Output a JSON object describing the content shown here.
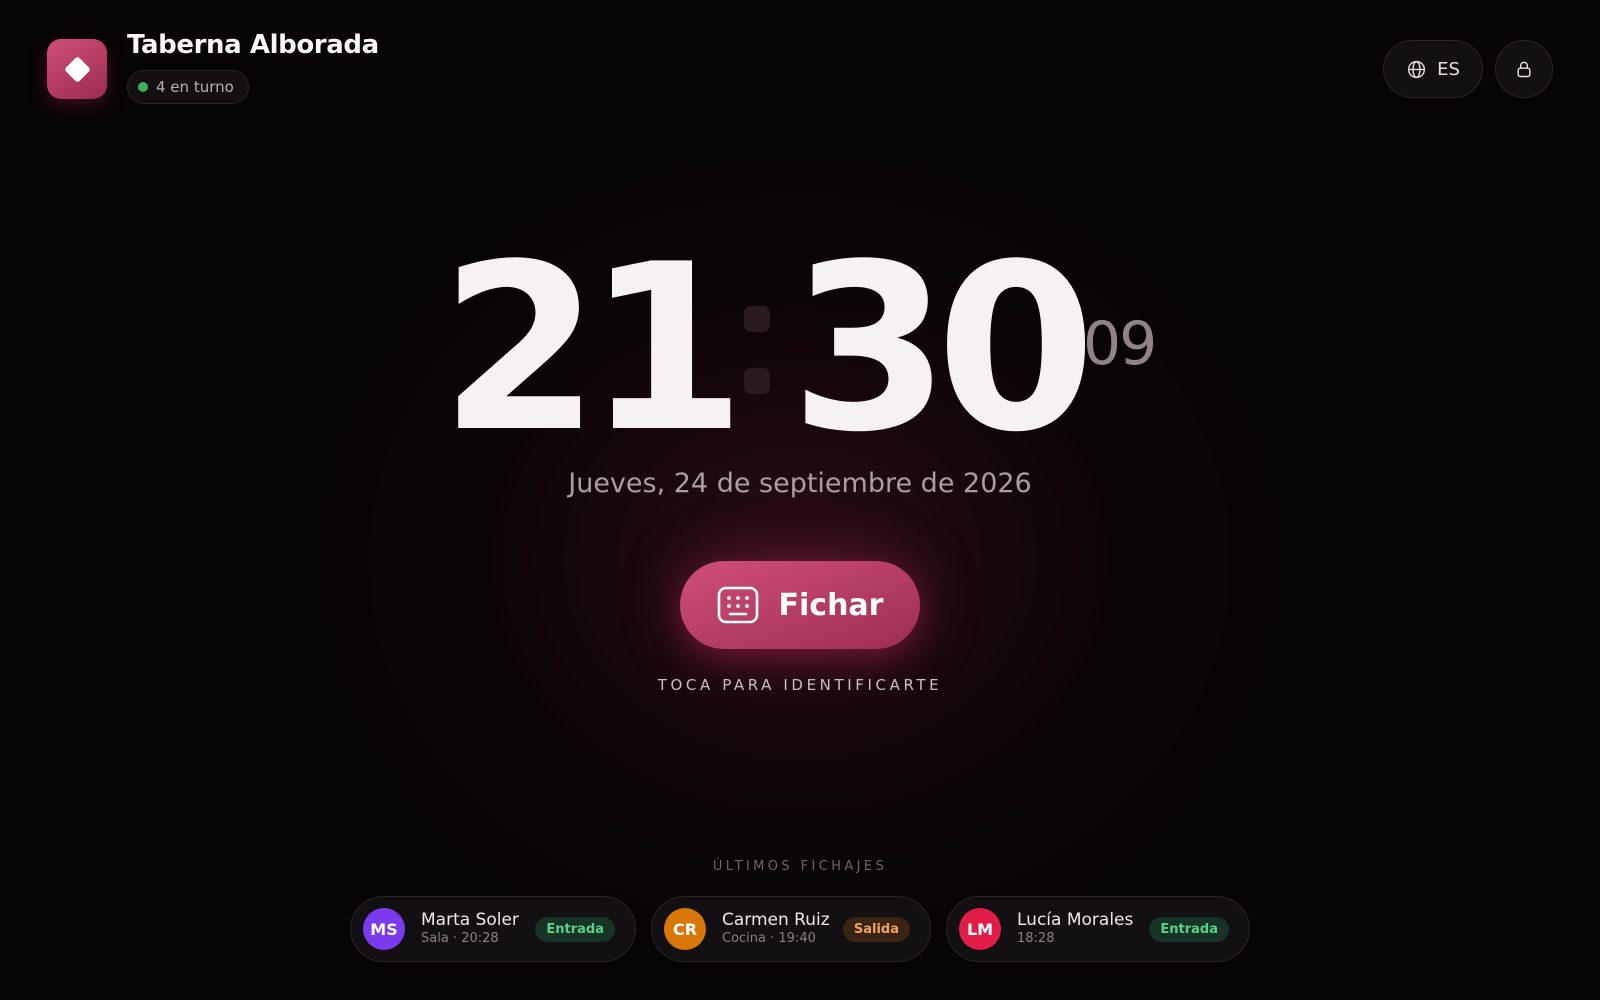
{
  "header": {
    "brand": "Taberna Alborada",
    "staff_on_shift": "4 en turno",
    "language": "ES",
    "logo_icon": "diamond-icon",
    "lock_icon": "lock-icon",
    "globe_icon": "globe-icon"
  },
  "clock": {
    "hours": "21",
    "minutes": "30",
    "seconds": "09",
    "date": "Jueves, 24 de septiembre de 2026"
  },
  "action": {
    "label": "Fichar",
    "icon": "keypad-icon",
    "hint": "TOCA PARA IDENTIFICARTE"
  },
  "recent": {
    "title": "ÚLTIMOS FICHAJES",
    "items": [
      {
        "initials": "MS",
        "name": "Marta Soler",
        "meta": "Sala · 20:28",
        "status": "Entrada",
        "avatar_color": "#7c3aed",
        "status_type": "in"
      },
      {
        "initials": "CR",
        "name": "Carmen Ruiz",
        "meta": "Cocina · 19:40",
        "status": "Salida",
        "avatar_color": "#d97706",
        "status_type": "out"
      },
      {
        "initials": "LM",
        "name": "Lucía Morales",
        "meta": "18:28",
        "status": "Entrada",
        "avatar_color": "#e11d48",
        "status_type": "in"
      }
    ]
  },
  "colors": {
    "accent": "#c2416a",
    "background": "#060405",
    "status_online": "#3fae62"
  }
}
